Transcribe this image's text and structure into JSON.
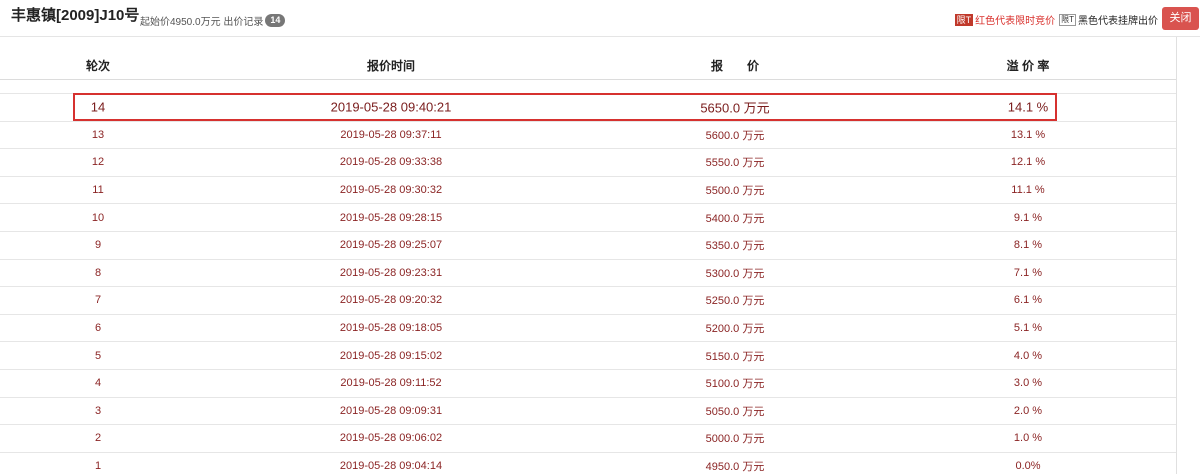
{
  "header": {
    "title": "丰惠镇[2009]J10号",
    "summary_text": "起始价4950.0万元 出价记录",
    "bid_count": "14",
    "legend_red_tag": "限T",
    "legend_red_text": "红色代表限时竞价",
    "legend_black_tag": "限T",
    "legend_black_text": "黑色代表挂牌出价",
    "close_label": "关闭"
  },
  "table": {
    "columns": [
      "轮次",
      "报价时间",
      "报　　价",
      "溢 价 率"
    ],
    "rows": [
      {
        "round": "14",
        "time": "2019-05-28 09:40:21",
        "price": "5650.0 万元",
        "premium": "14.1 %"
      },
      {
        "round": "13",
        "time": "2019-05-28 09:37:11",
        "price": "5600.0 万元",
        "premium": "13.1 %"
      },
      {
        "round": "12",
        "time": "2019-05-28 09:33:38",
        "price": "5550.0 万元",
        "premium": "12.1 %"
      },
      {
        "round": "11",
        "time": "2019-05-28 09:30:32",
        "price": "5500.0 万元",
        "premium": "11.1 %"
      },
      {
        "round": "10",
        "time": "2019-05-28 09:28:15",
        "price": "5400.0 万元",
        "premium": "9.1 %"
      },
      {
        "round": "9",
        "time": "2019-05-28 09:25:07",
        "price": "5350.0 万元",
        "premium": "8.1 %"
      },
      {
        "round": "8",
        "time": "2019-05-28 09:23:31",
        "price": "5300.0 万元",
        "premium": "7.1 %"
      },
      {
        "round": "7",
        "time": "2019-05-28 09:20:32",
        "price": "5250.0 万元",
        "premium": "6.1 %"
      },
      {
        "round": "6",
        "time": "2019-05-28 09:18:05",
        "price": "5200.0 万元",
        "premium": "5.1 %"
      },
      {
        "round": "5",
        "time": "2019-05-28 09:15:02",
        "price": "5150.0 万元",
        "premium": "4.0 %"
      },
      {
        "round": "4",
        "time": "2019-05-28 09:11:52",
        "price": "5100.0 万元",
        "premium": "3.0 %"
      },
      {
        "round": "3",
        "time": "2019-05-28 09:09:31",
        "price": "5050.0 万元",
        "premium": "2.0 %"
      },
      {
        "round": "2",
        "time": "2019-05-28 09:06:02",
        "price": "5000.0 万元",
        "premium": "1.0 %"
      },
      {
        "round": "1",
        "time": "2019-05-28 09:04:14",
        "price": "4950.0 万元",
        "premium": "0.0%"
      }
    ]
  },
  "colors": {
    "row_text": "#8b2424",
    "highlight_border": "#d6312f",
    "close_button": "#d9534f"
  }
}
